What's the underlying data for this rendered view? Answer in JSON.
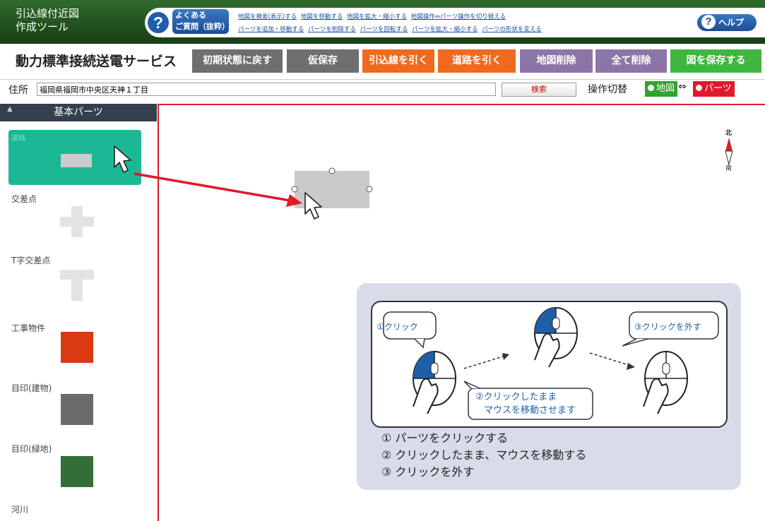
{
  "app": {
    "title_line1": "引込線付近図",
    "title_line2": "作成ツール",
    "service_name": "動力標準接続送電サービス"
  },
  "faq": {
    "icon": "question-icon",
    "label_line1": "よくある",
    "label_line2": "ご質問（抜粋）",
    "links_row1": [
      "地図を検索(表示)する",
      "地図を移動する",
      "地図を拡大・縮小する",
      "地図操作⇔パーツ操作を切り替える"
    ],
    "links_row2": [
      "パーツを追加・移動する",
      "パーツを削除する",
      "パーツを回転する",
      "パーツを拡大・縮小する",
      "パーツの形状を変える"
    ]
  },
  "help": {
    "label": "ヘルプ",
    "icon": "question-icon"
  },
  "toolbar": [
    {
      "label": "初期状態に戻す",
      "color": "#6f6f6f"
    },
    {
      "label": "仮保存",
      "color": "#6f6f6f"
    },
    {
      "label": "引込線を引く",
      "color": "#ef6a1f"
    },
    {
      "label": "道路を引く",
      "color": "#ef6a1f"
    },
    {
      "label": "地図削除",
      "color": "#8e75a7"
    },
    {
      "label": "全て削除",
      "color": "#8e75a7"
    },
    {
      "label": "図を保存する",
      "color": "#3fb73f"
    }
  ],
  "address": {
    "label": "住所",
    "value": "福岡県福岡市中央区天神１丁目",
    "search_label": "検索"
  },
  "switch": {
    "label": "操作切替",
    "map_label": "地図",
    "arrow": "⇔",
    "parts_label": "パーツ",
    "map_color": "#2fa52f",
    "parts_color": "#e0192b"
  },
  "sidebar": {
    "header": "基本パーツ",
    "items": [
      {
        "label": "道路",
        "color": "#cccccc"
      },
      {
        "label": "交差点",
        "color": "#e3e3e3"
      },
      {
        "label": "T字交差点",
        "color": "#e3e3e3"
      },
      {
        "label": "工事物件",
        "color": "#d93a12"
      },
      {
        "label": "目印(建物)",
        "color": "#6b6b6b"
      },
      {
        "label": "目印(緑地)",
        "color": "#336e36"
      },
      {
        "label": "河川",
        "color": ""
      }
    ]
  },
  "compass": {
    "north": "北",
    "south": "南"
  },
  "instructions": {
    "bubble1": "①クリック",
    "bubble2_line1": "②クリックしたまま",
    "bubble2_line2": "マウスを移動させます",
    "bubble3": "③クリックを外す",
    "steps": [
      "①  パーツをクリックする",
      "②  クリックしたまま、マウスを移動する",
      "③  クリックを外す"
    ]
  },
  "colors": {
    "selected_part_bg": "#1cb896",
    "drag_arrow": "#e0192b",
    "mouse_click": "#1e5fa8"
  }
}
